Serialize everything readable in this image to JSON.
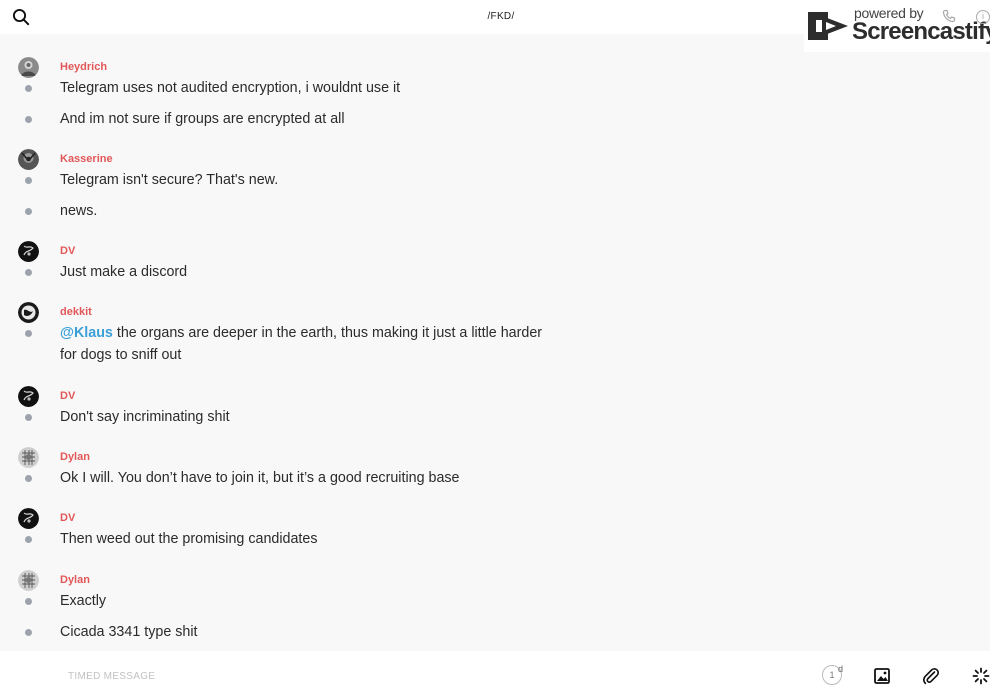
{
  "header": {
    "channel": "/FKD/"
  },
  "watermark": {
    "powered": "powered by",
    "brand": "Screencastify",
    "info": "i"
  },
  "messages": [
    {
      "author": "Heydrich",
      "avatar": "avatar-1",
      "lines": [
        [
          "Telegram uses not audited encryption, i wouldnt use it"
        ],
        [
          "And im not sure if groups are encrypted at all"
        ]
      ]
    },
    {
      "author": "Kasserine",
      "avatar": "avatar-2",
      "lines": [
        [
          "Telegram isn't secure? That's new."
        ],
        [
          "news."
        ]
      ]
    },
    {
      "author": "DV",
      "avatar": "avatar-3",
      "lines": [
        [
          "Just make a discord"
        ]
      ]
    },
    {
      "author": "dekkit",
      "avatar": "avatar-4",
      "mention": "@Klaus",
      "lines": [
        [
          "the organs are deeper in the earth, thus making it just a little harder",
          "for dogs to sniff out"
        ]
      ]
    },
    {
      "author": "DV",
      "avatar": "avatar-3",
      "lines": [
        [
          "Don't say incriminating shit"
        ]
      ]
    },
    {
      "author": "Dylan",
      "avatar": "avatar-5",
      "lines": [
        [
          "Ok I will. You don’t have to join it, but it’s a good recruiting base"
        ]
      ]
    },
    {
      "author": "DV",
      "avatar": "avatar-3",
      "lines": [
        [
          "Then weed out the promising candidates"
        ]
      ]
    },
    {
      "author": "Dylan",
      "avatar": "avatar-5",
      "lines": [
        [
          "Exactly"
        ],
        [
          "Cicada 3341 type shit"
        ]
      ]
    }
  ],
  "composer": {
    "placeholder": "TIMED MESSAGE",
    "timer_value": "1",
    "timer_unit": "d",
    "icons": [
      "image-icon",
      "paperclip-icon",
      "sparkle-icon"
    ]
  },
  "colors": {
    "author": "#e25858",
    "mention": "#3aa0d8",
    "bullet": "#9da3ad",
    "background": "#f8f8f9"
  }
}
